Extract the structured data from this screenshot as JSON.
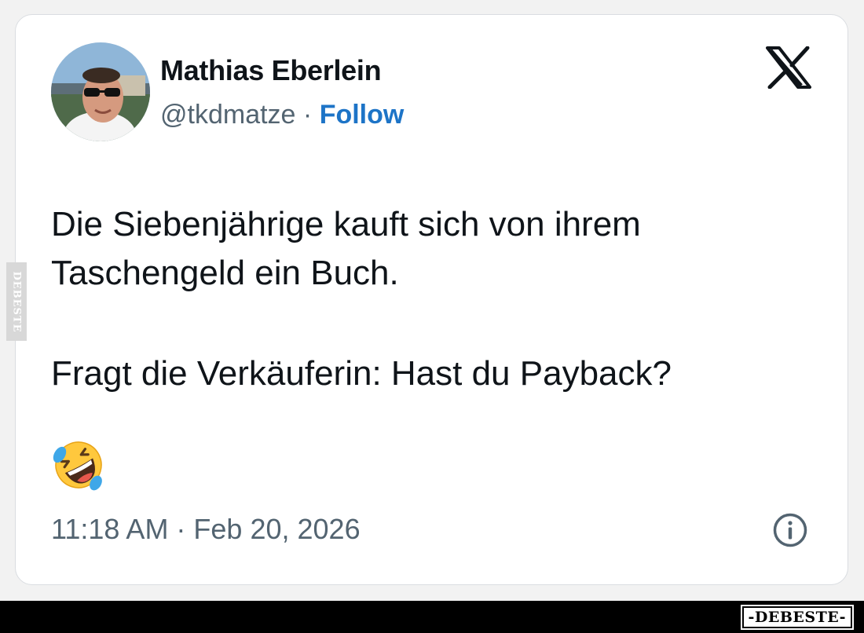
{
  "tweet": {
    "author_name": "Mathias Eberlein",
    "handle": "@tkdmatze",
    "separator": " · ",
    "follow_label": "Follow",
    "text_line1": "Die Siebenjährige kauft sich von ihrem Taschengeld ein Buch.",
    "text_line2": "Fragt die Verkäuferin: Hast du Payback?",
    "emoji": "🤣",
    "timestamp": "11:18 AM · Feb 20, 2026"
  },
  "icons": {
    "platform_logo": "x-logo-icon",
    "info": "info-icon",
    "emoji": "rolling-on-floor-laughing-emoji"
  },
  "watermark": {
    "side_text": "DEBESTE",
    "badge_text": "-DEBESTE-"
  },
  "colors": {
    "follow": "#1d74c7",
    "text": "#0f1419",
    "secondary": "#536471"
  }
}
